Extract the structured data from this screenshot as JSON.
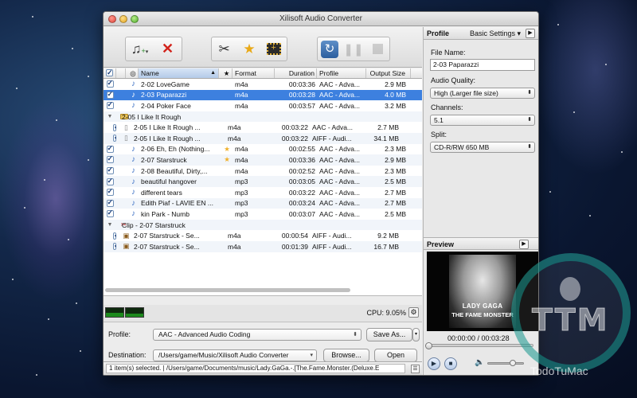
{
  "window": {
    "title": "Xilisoft Audio Converter"
  },
  "toolbar": {
    "add_icon": "add-music-icon",
    "remove_icon": "remove-x-icon",
    "clip_icon": "scissors-icon",
    "effect_icon": "star-icon",
    "merge_icon": "film-merge-icon",
    "convert_icon": "convert-refresh-icon",
    "pause_icon": "pause-icon",
    "stop_icon": "stop-icon"
  },
  "table": {
    "columns": [
      "Name",
      "★",
      "Format",
      "Duration",
      "Profile",
      "Output Size"
    ],
    "rows": [
      {
        "indent": 0,
        "kind": "audio",
        "checked": true,
        "name": "2-02 LoveGame",
        "star": "",
        "format": "m4a",
        "duration": "00:03:36",
        "profile": "AAC - Adva...",
        "size": "2.9 MB",
        "selected": false
      },
      {
        "indent": 0,
        "kind": "audio",
        "checked": true,
        "name": "2-03 Paparazzi",
        "star": "",
        "format": "m4a",
        "duration": "00:03:28",
        "profile": "AAC - Adva...",
        "size": "4.0 MB",
        "selected": true
      },
      {
        "indent": 0,
        "kind": "audio",
        "checked": true,
        "name": "2-04 Poker Face",
        "star": "",
        "format": "m4a",
        "duration": "00:03:57",
        "profile": "AAC - Adva...",
        "size": "3.2 MB",
        "selected": false
      },
      {
        "indent": 0,
        "kind": "group",
        "checked": null,
        "name": "2-05 I Like It Rough",
        "star": "",
        "format": "",
        "duration": "",
        "profile": "",
        "size": "",
        "selected": false
      },
      {
        "indent": 1,
        "kind": "file",
        "checked": true,
        "name": "2-05 I Like It Rough ...",
        "star": "",
        "format": "m4a",
        "duration": "00:03:22",
        "profile": "AAC - Adva...",
        "size": "2.7 MB",
        "selected": false
      },
      {
        "indent": 1,
        "kind": "file",
        "checked": true,
        "name": "2-05 I Like It Rough ...",
        "star": "",
        "format": "m4a",
        "duration": "00:03:22",
        "profile": "AIFF - Audi...",
        "size": "34.1 MB",
        "selected": false
      },
      {
        "indent": 0,
        "kind": "audio",
        "checked": true,
        "name": "2-06 Eh, Eh (Nothing...",
        "star": "★",
        "format": "m4a",
        "duration": "00:02:55",
        "profile": "AAC - Adva...",
        "size": "2.3 MB",
        "selected": false
      },
      {
        "indent": 0,
        "kind": "audio",
        "checked": true,
        "name": "2-07 Starstruck",
        "star": "★",
        "format": "m4a",
        "duration": "00:03:36",
        "profile": "AAC - Adva...",
        "size": "2.9 MB",
        "selected": false
      },
      {
        "indent": 0,
        "kind": "audio",
        "checked": true,
        "name": "2-08 Beautiful, Dirty,...",
        "star": "",
        "format": "m4a",
        "duration": "00:02:52",
        "profile": "AAC - Adva...",
        "size": "2.3 MB",
        "selected": false
      },
      {
        "indent": 0,
        "kind": "audio",
        "checked": true,
        "name": "beautiful hangover",
        "star": "",
        "format": "mp3",
        "duration": "00:03:05",
        "profile": "AAC - Adva...",
        "size": "2.5 MB",
        "selected": false
      },
      {
        "indent": 0,
        "kind": "audio",
        "checked": true,
        "name": "different tears",
        "star": "",
        "format": "mp3",
        "duration": "00:03:22",
        "profile": "AAC - Adva...",
        "size": "2.7 MB",
        "selected": false
      },
      {
        "indent": 0,
        "kind": "audio",
        "checked": true,
        "name": "Edith Piaf - LAVIE EN ...",
        "star": "",
        "format": "mp3",
        "duration": "00:03:24",
        "profile": "AAC - Adva...",
        "size": "2.7 MB",
        "selected": false
      },
      {
        "indent": 0,
        "kind": "audio",
        "checked": true,
        "name": "kin Park - Numb",
        "star": "",
        "format": "mp3",
        "duration": "00:03:07",
        "profile": "AAC - Adva...",
        "size": "2.5 MB",
        "selected": false
      },
      {
        "indent": 0,
        "kind": "clipgroup",
        "checked": null,
        "name": "Clip - 2-07 Starstruck",
        "star": "",
        "format": "",
        "duration": "",
        "profile": "",
        "size": "",
        "selected": false
      },
      {
        "indent": 1,
        "kind": "clip",
        "checked": true,
        "name": "2-07 Starstruck - Se...",
        "star": "",
        "format": "m4a",
        "duration": "00:00:54",
        "profile": "AIFF - Audi...",
        "size": "9.2 MB",
        "selected": false
      },
      {
        "indent": 1,
        "kind": "clip",
        "checked": true,
        "name": "2-07 Starstruck - Se...",
        "star": "",
        "format": "m4a",
        "duration": "00:01:39",
        "profile": "AIFF - Audi...",
        "size": "16.7 MB",
        "selected": false
      }
    ]
  },
  "cpu": {
    "label": "CPU: 9.05%",
    "meter1": 0.45,
    "meter2": 0.35
  },
  "bottom": {
    "profile_label": "Profile:",
    "profile_value": "AAC - Advanced Audio Coding",
    "save_as_label": "Save As...",
    "destination_label": "Destination:",
    "destination_value": "/Users/game/Music/Xilisoft Audio Converter",
    "browse_label": "Browse...",
    "open_label": "Open"
  },
  "status": {
    "text": "1 item(s) selected. | /Users/game/Documents/music/Lady.GaGa.-.[The.Fame.Monster.(Deluxe.E"
  },
  "panel": {
    "title": "Profile",
    "settings_label": "Basic Settings",
    "file_name_label": "File Name:",
    "file_name_value": "2-03 Paparazzi",
    "quality_label": "Audio Quality:",
    "quality_value": "High (Larger file size)",
    "channels_label": "Channels:",
    "channels_value": "5.1",
    "split_label": "Split:",
    "split_value": "CD-R/RW 650 MB"
  },
  "preview": {
    "title": "Preview",
    "cover_line1": "LADY GAGA",
    "cover_line2": "THE FAME MONSTER",
    "timecode": "00:00:00 / 00:03:28",
    "progress": 0.0
  },
  "watermark": {
    "logo": "TTM",
    "caption": "TodoTuMac"
  }
}
